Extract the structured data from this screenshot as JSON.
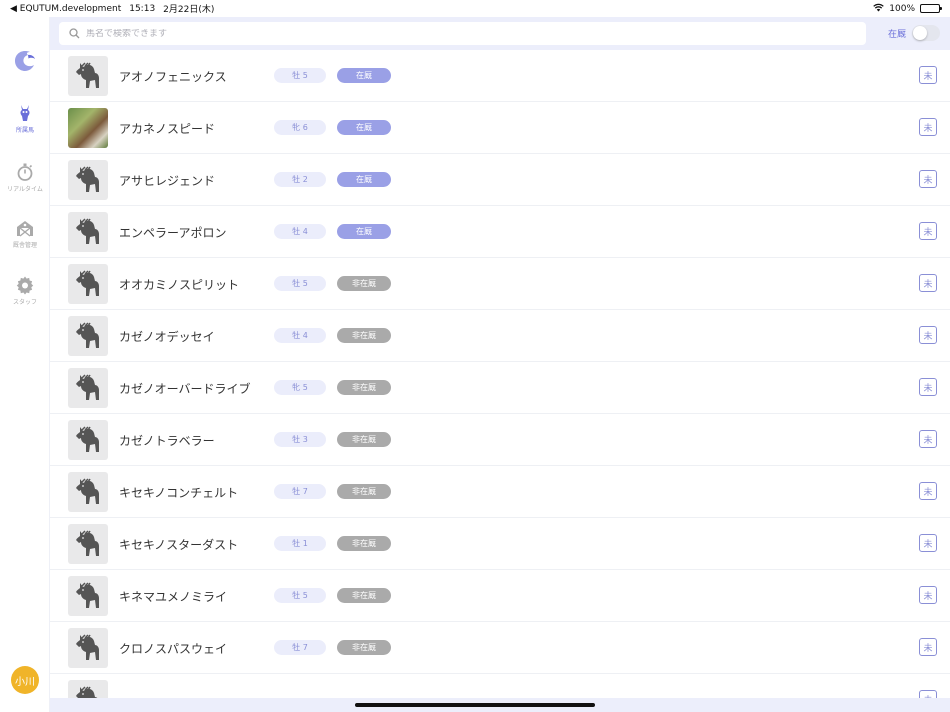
{
  "status_bar": {
    "app": "◀ EQUTUM.development",
    "time": "15:13",
    "date": "2月22日(木)",
    "battery": "100%"
  },
  "sidebar": {
    "items": [
      {
        "label": "所属馬",
        "icon": "horse-head-icon",
        "active": true
      },
      {
        "label": "リアルタイム",
        "icon": "stopwatch-icon",
        "active": false
      },
      {
        "label": "厩舎管理",
        "icon": "stable-icon",
        "active": false
      },
      {
        "label": "スタッフ",
        "icon": "gear-icon",
        "active": false
      }
    ],
    "avatar": "小川"
  },
  "search": {
    "placeholder": "馬名で検索できます"
  },
  "filter": {
    "label": "在厩",
    "on": false
  },
  "colors": {
    "accent": "#6a6fd9",
    "status_in": "#9aa0e6",
    "status_out": "#aaaaaa"
  },
  "horses": [
    {
      "name": "アオノフェニックス",
      "sex": "牡 5",
      "status": "在厩",
      "in": true,
      "photo": false,
      "mark": "未"
    },
    {
      "name": "アカネノスピード",
      "sex": "牝 6",
      "status": "在厩",
      "in": true,
      "photo": true,
      "mark": "未"
    },
    {
      "name": "アサヒレジェンド",
      "sex": "牡 2",
      "status": "在厩",
      "in": true,
      "photo": false,
      "mark": "未"
    },
    {
      "name": "エンペラーアポロン",
      "sex": "牡 4",
      "status": "在厩",
      "in": true,
      "photo": false,
      "mark": "未"
    },
    {
      "name": "オオカミノスピリット",
      "sex": "牡 5",
      "status": "非在厩",
      "in": false,
      "photo": false,
      "mark": "未"
    },
    {
      "name": "カゼノオデッセイ",
      "sex": "牡 4",
      "status": "非在厩",
      "in": false,
      "photo": false,
      "mark": "未"
    },
    {
      "name": "カゼノオーバードライブ",
      "sex": "牝 5",
      "status": "非在厩",
      "in": false,
      "photo": false,
      "mark": "未"
    },
    {
      "name": "カゼノトラベラー",
      "sex": "牡 3",
      "status": "非在厩",
      "in": false,
      "photo": false,
      "mark": "未"
    },
    {
      "name": "キセキノコンチェルト",
      "sex": "牡 7",
      "status": "非在厩",
      "in": false,
      "photo": false,
      "mark": "未"
    },
    {
      "name": "キセキノスターダスト",
      "sex": "牡 1",
      "status": "非在厩",
      "in": false,
      "photo": false,
      "mark": "未"
    },
    {
      "name": "キネマユメノミライ",
      "sex": "牡 5",
      "status": "非在厩",
      "in": false,
      "photo": false,
      "mark": "未"
    },
    {
      "name": "クロノスパスウェイ",
      "sex": "牡 7",
      "status": "非在厩",
      "in": false,
      "photo": false,
      "mark": "未"
    },
    {
      "name": "",
      "sex": "",
      "status": "",
      "in": false,
      "photo": false,
      "mark": "未"
    }
  ]
}
